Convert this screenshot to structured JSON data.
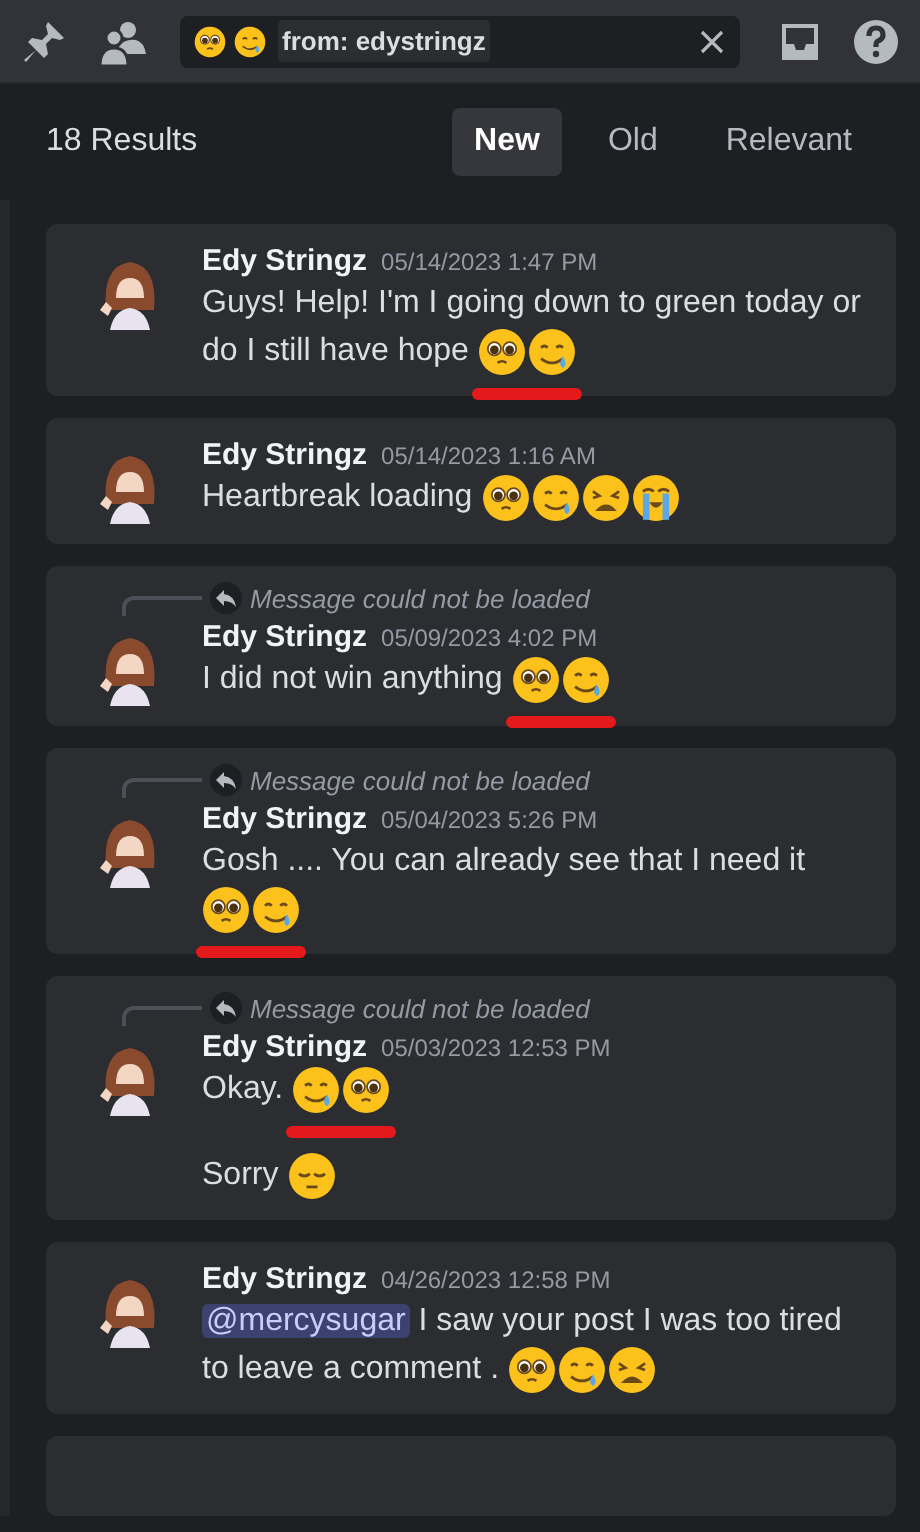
{
  "toolbar": {
    "search": {
      "emojis": [
        {
          "kind": "pleading"
        },
        {
          "kind": "tear-smile"
        }
      ],
      "filter": "from: edystringz"
    }
  },
  "results": {
    "count": "18 Results",
    "sorts": [
      {
        "label": "New",
        "selected": true
      },
      {
        "label": "Old",
        "selected": false
      },
      {
        "label": "Relevant",
        "selected": false
      }
    ]
  },
  "messages": [
    {
      "author": "Edy Stringz",
      "time": "05/14/2023 1:47 PM",
      "lines": [
        {
          "text": "Guys! Help! I'm I going down to green today or do I still have hope",
          "emojis": [
            {
              "kind": "pleading"
            },
            {
              "kind": "tear-smile"
            }
          ],
          "underlined": true
        }
      ]
    },
    {
      "author": "Edy Stringz",
      "time": "05/14/2023 1:16 AM",
      "lines": [
        {
          "text": "Heartbreak loading",
          "emojis": [
            {
              "kind": "pleading"
            },
            {
              "kind": "tear-smile"
            },
            {
              "kind": "weary"
            },
            {
              "kind": "sob"
            }
          ],
          "underlined": false
        }
      ]
    },
    {
      "reply": "Message could not be loaded",
      "author": "Edy Stringz",
      "time": "05/09/2023 4:02 PM",
      "lines": [
        {
          "text": "I did not win anything",
          "emojis": [
            {
              "kind": "pleading"
            },
            {
              "kind": "tear-smile"
            }
          ],
          "underlined": true
        }
      ]
    },
    {
      "reply": "Message could not be loaded",
      "author": "Edy Stringz",
      "time": "05/04/2023 5:26 PM",
      "lines": [
        {
          "text": "Gosh .... You can already see that I need it",
          "emojis": [
            {
              "kind": "pleading"
            },
            {
              "kind": "tear-smile"
            }
          ],
          "underlined": true
        }
      ]
    },
    {
      "reply": "Message could not be loaded",
      "author": "Edy Stringz",
      "time": "05/03/2023 12:53 PM",
      "lines": [
        {
          "text": "Okay.",
          "emojis": [
            {
              "kind": "tear-smile"
            },
            {
              "kind": "pleading"
            }
          ],
          "underlined": true
        },
        {
          "text": "Sorry",
          "emojis": [
            {
              "kind": "pensive"
            }
          ],
          "underlined": false
        }
      ]
    },
    {
      "author": "Edy Stringz",
      "time": "04/26/2023 12:58 PM",
      "lines": [
        {
          "mention": "@mercysugar",
          "text": "I saw your post I was too tired to leave a comment .",
          "emojis": [
            {
              "kind": "pleading"
            },
            {
              "kind": "tear-smile"
            },
            {
              "kind": "weary"
            }
          ],
          "underlined": false
        }
      ]
    }
  ]
}
